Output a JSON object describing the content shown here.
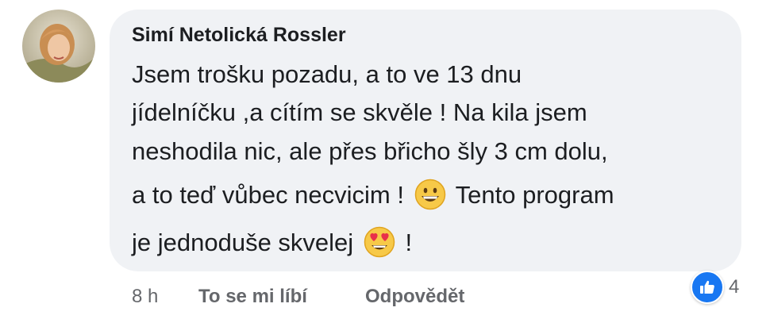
{
  "comment": {
    "author": "Simí Netolická Rossler",
    "lines": [
      "Jsem trošku pozadu, a to ve 13 dnu",
      "jídelníčku ,a cítím se skvěle ! Na kila jsem",
      "neshodila nic, ale přes břicho šly 3 cm dolu,",
      "a to teď vůbec necvicim !",
      "Tento program",
      "je jednoduše skvelej",
      "!"
    ],
    "emojis": [
      "grinning-face-emoji",
      "heart-eyes-emoji"
    ]
  },
  "actions": {
    "time": "8 h",
    "like_label": "To se mi líbí",
    "reply_label": "Odpovědět"
  },
  "reactions": {
    "icon": "thumbs-up-icon",
    "count": "4",
    "color": "#1877f2"
  }
}
